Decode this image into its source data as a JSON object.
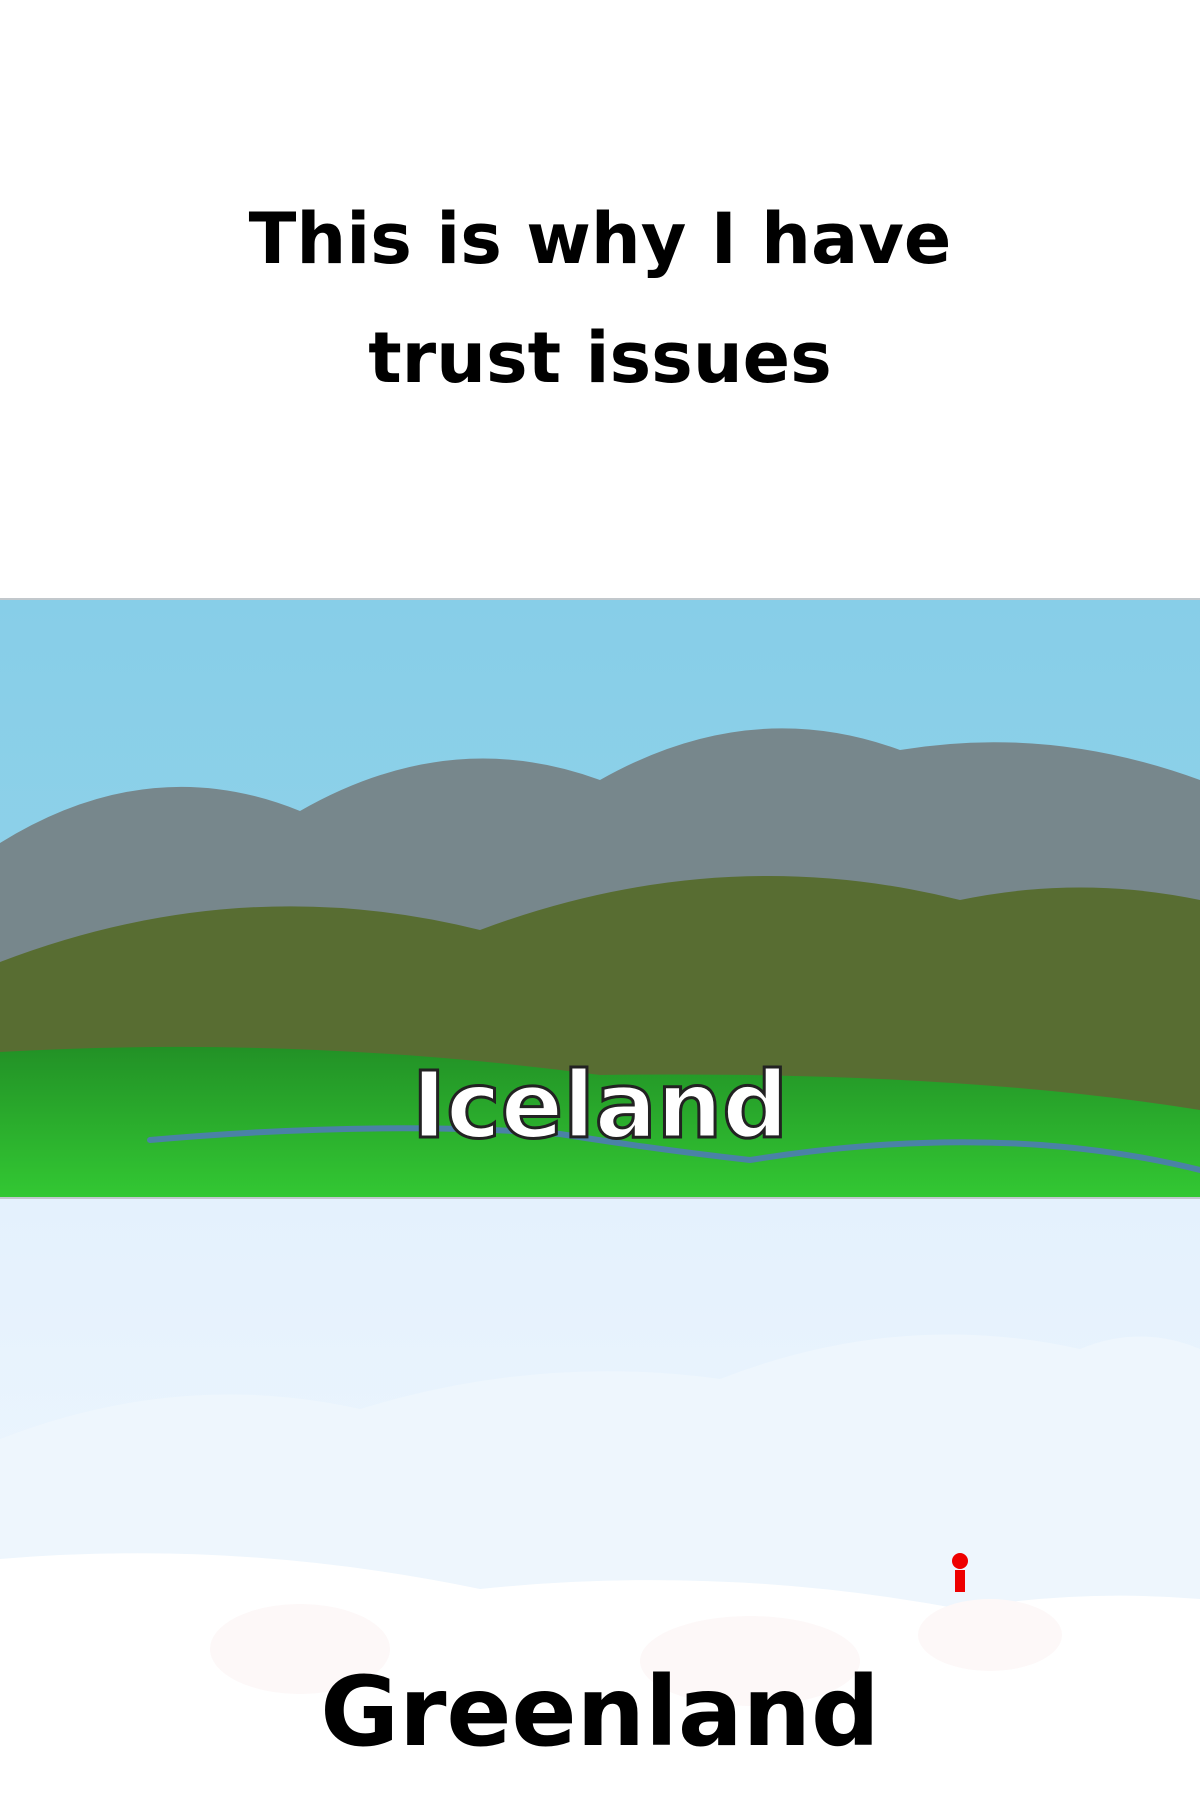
{
  "caption": {
    "text": "This is why I have trust issues"
  },
  "panels": [
    {
      "label": "Iceland",
      "scene": "green-hills-landscape",
      "colors": {
        "sky_top": "#87CEE8",
        "sky_bottom": "#95D4EA",
        "mountains": "#77878C",
        "dark_hills": "#586D32",
        "grass_top": "#229126",
        "grass_bottom": "#33C933",
        "river": "#4A82A6"
      }
    },
    {
      "label": "Greenland",
      "scene": "snow-and-ice-landscape",
      "colors": {
        "sky_top": "#E4F1FD",
        "sky_bottom": "#F2F8FE",
        "ice_hills": "#EEF6FD",
        "snow": "#FFFFFF",
        "snow_shadow": "#FDF8F8",
        "person": "#EE0000"
      }
    }
  ]
}
